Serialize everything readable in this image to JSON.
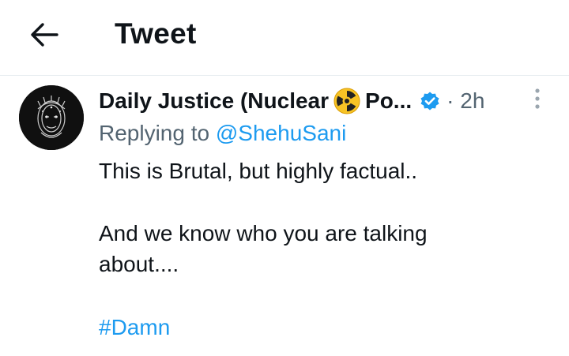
{
  "header": {
    "title": "Tweet",
    "back_icon": "arrow-left-icon"
  },
  "tweet": {
    "author": {
      "display_name_start": "Daily Justice (Nuclear",
      "display_name_end": "Po...",
      "emoji_icon": "radioactive-icon",
      "verified_icon": "verified-badge-icon",
      "verified_color": "#1d9bf0"
    },
    "time": "· 2h",
    "more_icon": "more-vertical-icon",
    "replying_label": "Replying to",
    "replying_handle": "@ShehuSani",
    "lines": [
      "This is Brutal, but highly factual..",
      "And we know who you are talking",
      "about...."
    ],
    "hashtag": "#Damn"
  },
  "colors": {
    "accent": "#1d9bf0",
    "text": "#0f1419",
    "muted": "#536471",
    "divider": "#e6ecf0"
  }
}
